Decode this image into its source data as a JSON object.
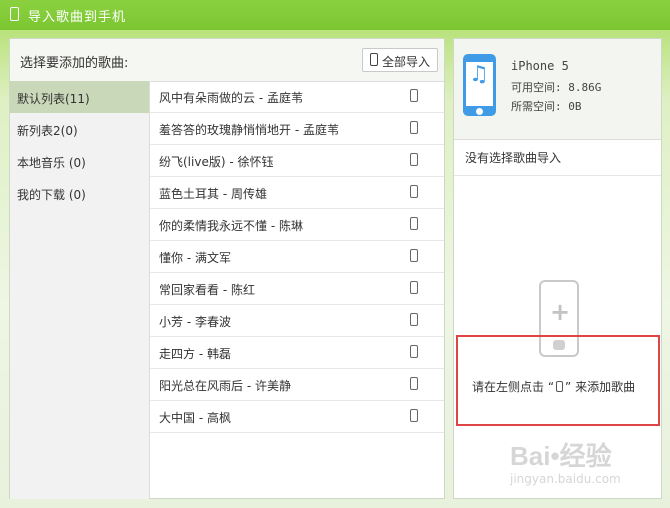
{
  "window": {
    "title": "导入歌曲到手机",
    "title_icon": "phone-icon",
    "accent": "#7cc632"
  },
  "left": {
    "title": "选择要添加的歌曲:",
    "import_all_label": "全部导入",
    "import_all_icon": "phone-icon",
    "playlists": [
      {
        "label": "默认列表(11)",
        "active": true
      },
      {
        "label": "新列表2(0)",
        "active": false
      },
      {
        "label": "本地音乐 (0)",
        "active": false
      },
      {
        "label": "我的下载 (0)",
        "active": false
      }
    ],
    "songs": [
      {
        "name": "风中有朵雨做的云 - 孟庭苇"
      },
      {
        "name": "羞答答的玫瑰静悄悄地开 - 孟庭苇"
      },
      {
        "name": "纷飞(live版) - 徐怀钰"
      },
      {
        "name": "蓝色土耳其 - 周传雄"
      },
      {
        "name": "你的柔情我永远不懂 - 陈琳"
      },
      {
        "name": "懂你 - 满文军"
      },
      {
        "name": "常回家看看 - 陈红"
      },
      {
        "name": "小芳 - 李春波"
      },
      {
        "name": "走四方 - 韩磊"
      },
      {
        "name": "阳光总在风雨后 - 许美静"
      },
      {
        "name": "大中国 - 高枫"
      }
    ]
  },
  "device": {
    "name": "iPhone 5",
    "available": "可用空间: 8.86G",
    "required": "所需空间: 0B",
    "icon": "music-note-icon",
    "color": "#3f9be6"
  },
  "right": {
    "status": "没有选择歌曲导入",
    "hint_before": "请在左侧点击 “",
    "hint_after": "” 来添加歌曲",
    "highlight_color": "#e04545"
  },
  "watermark": {
    "brand": "Bai•经验",
    "url": "jingyan.baidu.com"
  }
}
